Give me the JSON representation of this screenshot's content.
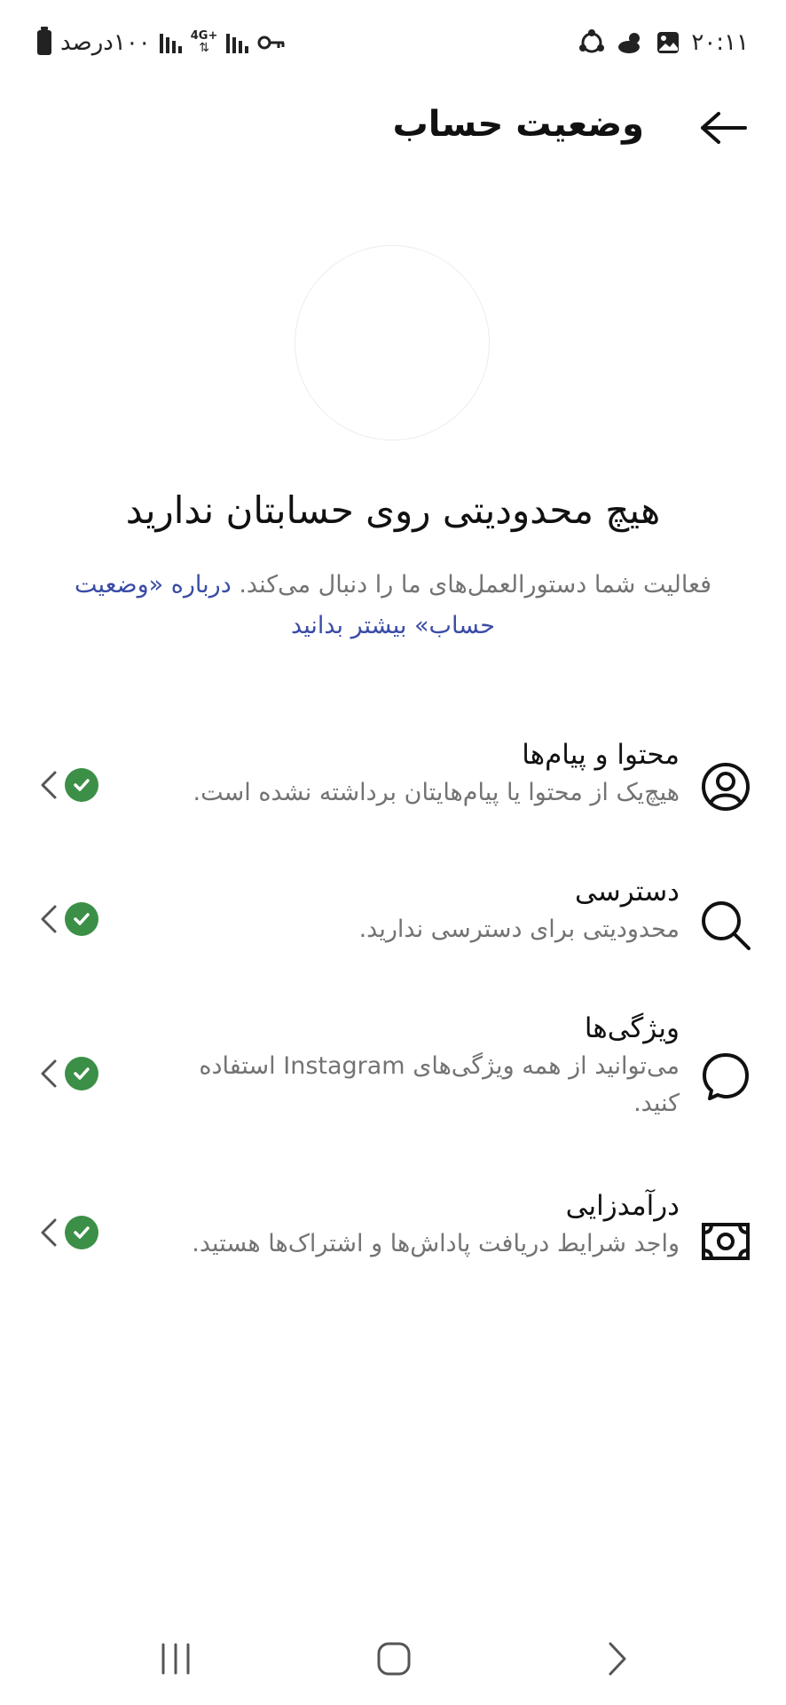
{
  "status_bar": {
    "time": "۲۰:۱۱",
    "battery_text": "۱۰۰درصد",
    "network_type": "4G+",
    "icons": [
      "weather-icon",
      "gallery-icon",
      "sync-icon",
      "key-icon",
      "signal-icon",
      "battery-icon"
    ]
  },
  "header": {
    "title": "وضعیت حساب",
    "back_icon": "arrow-right-icon"
  },
  "hero": {
    "headline": "هیچ محدودیتی روی حسابتان ندارید",
    "description": "فعالیت شما دستورالعمل‌های ما را دنبال می‌کند.",
    "learn_more_link": "درباره «وضعیت حساب» بیشتر بدانید"
  },
  "status_items": [
    {
      "title": "محتوا و پیام‌ها",
      "description": "هیچ‌یک از محتوا یا پیام‌هایتان برداشته نشده است.",
      "icon": "person-circle-icon",
      "status": "ok"
    },
    {
      "title": "دسترسی",
      "description": "محدودیتی برای دسترسی ندارید.",
      "icon": "search-icon",
      "status": "ok"
    },
    {
      "title": "ویژگی‌ها",
      "description": "می‌توانید از همه ویژگی‌های Instagram استفاده کنید.",
      "icon": "message-bubble-icon",
      "status": "ok"
    },
    {
      "title": "درآمدزایی",
      "description": "واجد شرایط دریافت پاداش‌ها و اشتراک‌ها هستید.",
      "icon": "money-icon",
      "status": "ok"
    }
  ],
  "colors": {
    "check_green": "#3c8f46",
    "link_blue": "#3a4ca6",
    "secondary_text": "#737373"
  },
  "nav_bar": {
    "icons": [
      "recent-apps-icon",
      "home-icon",
      "back-icon"
    ]
  }
}
